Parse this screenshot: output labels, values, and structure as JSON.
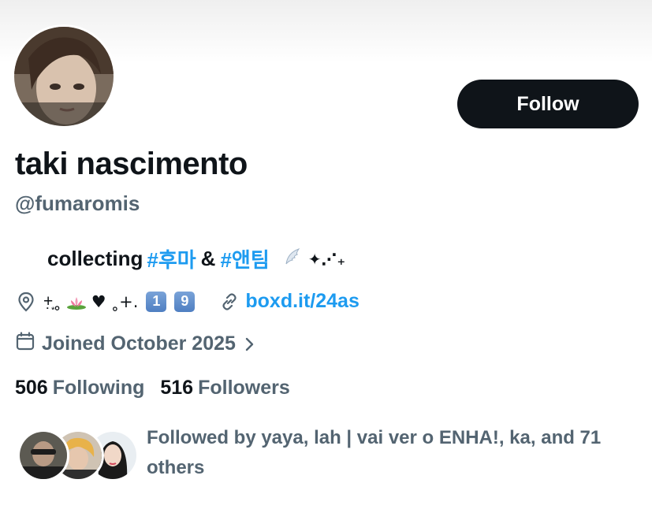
{
  "profile": {
    "display_name": "taki nascimento",
    "handle": "@fumaromis",
    "follow_label": "Follow"
  },
  "bio": {
    "text_before": "collecting",
    "tag1": "#후마",
    "amp": "&",
    "tag2": "#앤팀",
    "emoji_wing": "wing-emoji",
    "sparkle": "✦⋰₊"
  },
  "location": {
    "icon": "location-pin-icon",
    "part1": "+̣͙˳",
    "lotus": "lotus-emoji",
    "heart": "♥",
    "part2": "˳+.",
    "key1": "1",
    "key2": "9"
  },
  "website": {
    "icon": "link-icon",
    "text": "boxd.it/24as"
  },
  "joined": {
    "icon": "calendar-icon",
    "text": "Joined October 2025"
  },
  "stats": {
    "following_count": "506",
    "following_label": "Following",
    "followers_count": "516",
    "followers_label": "Followers"
  },
  "followed_by": {
    "text": "Followed by yaya, lah | vai ver o ENHA!, ka, and 71 others"
  },
  "colors": {
    "accent": "#1d9bf0",
    "text_primary": "#0f1419",
    "text_secondary": "#536471",
    "button_bg": "#0f1419"
  }
}
